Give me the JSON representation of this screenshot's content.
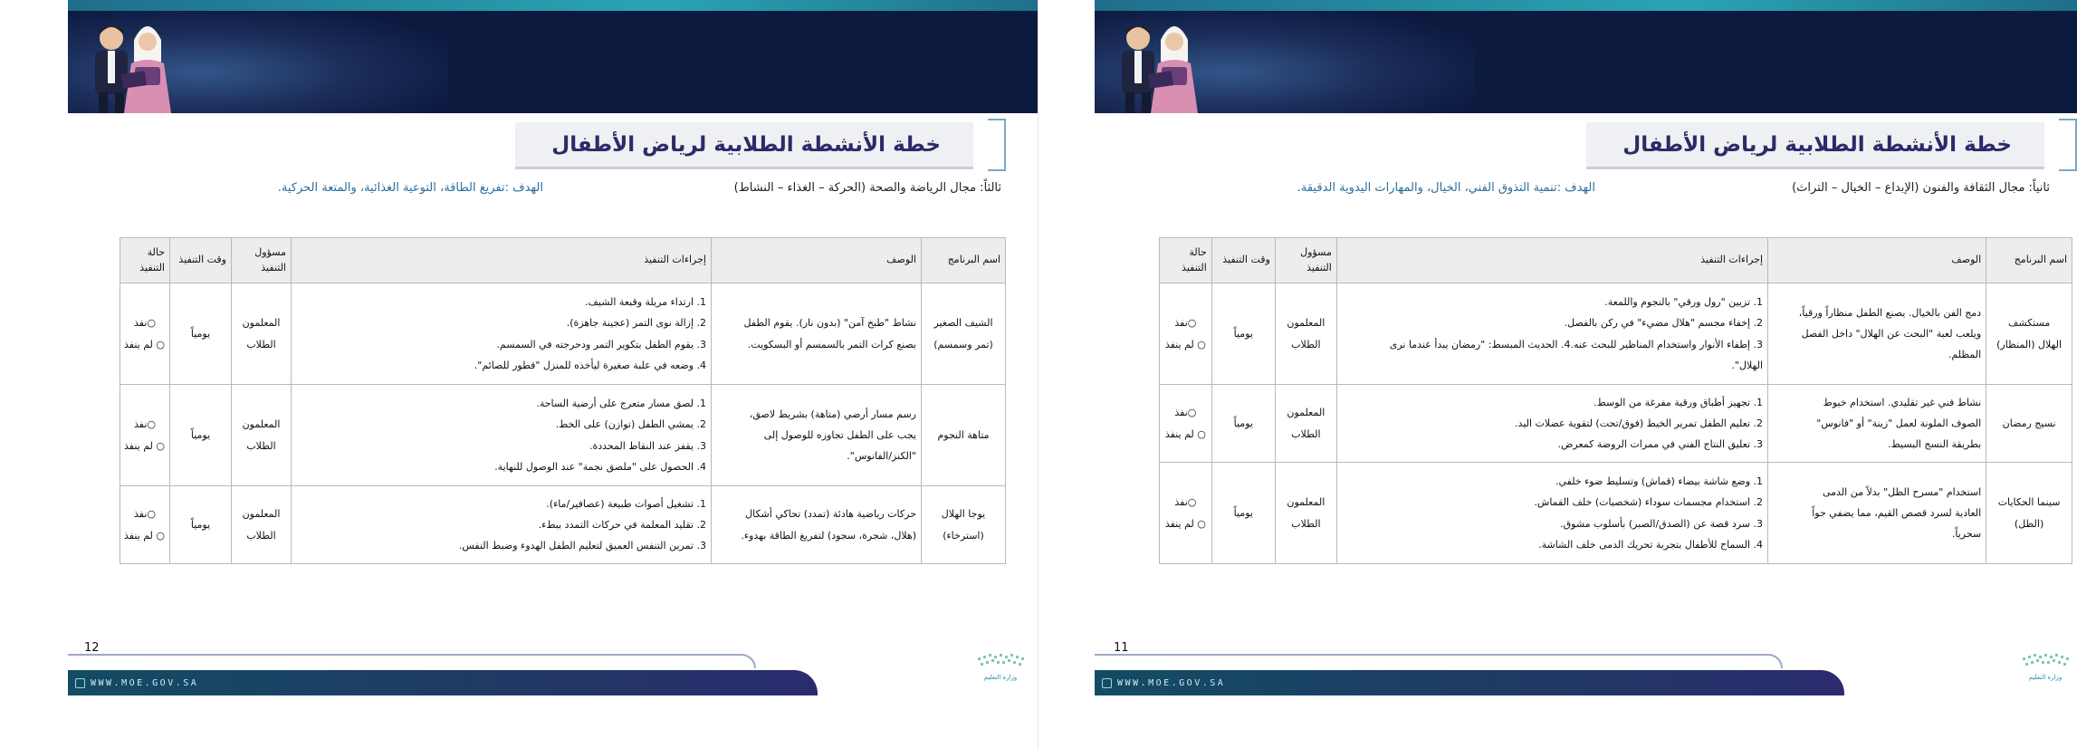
{
  "pages": [
    {
      "page_number": "12",
      "title": "خطة الأنشطة الطلابية لرياض الأطفال",
      "domain": "ثالثاً: مجال الرياضة والصحة (الحركة – الغذاء – النشاط)",
      "goal": "الهدف :تفريغ الطاقة، التوعية الغذائية، والمتعة الحركية.",
      "headers": {
        "name": "اسم البرنامج",
        "desc": "الوصف",
        "steps": "إجراءات التنفيذ",
        "resp_1": "مسؤول",
        "resp_2": "التنفيذ",
        "time": "وقت التنفيذ",
        "status_1": "حالة",
        "status_2": "التنفيذ"
      },
      "rows": [
        {
          "name_1": "الشيف الصغير",
          "name_2": "(تمر وسمسم)",
          "desc_1": "نشاط \"طبخ آمن\" (بدون نار). يقوم الطفل",
          "desc_2": "بصنع كرات التمر بالسمسم أو البسكويت.",
          "desc_3": "",
          "steps": [
            "1. ارتداء مريلة وقبعة الشيف.",
            "2. إزالة نوى التمر (عجينة جاهزة).",
            "3. يقوم الطفل بتكوير التمر ودحرجته في السمسم.",
            "4. وضعه في علبة صغيرة ليأخذه للمنزل \"فطور للصائم\"."
          ],
          "resp_1": "المعلمون",
          "resp_2": "الطلاب",
          "time": "يومياً",
          "status_done": "○نفذ",
          "status_not": "○ لم ينفذ"
        },
        {
          "name_1": "متاهة النجوم",
          "name_2": "",
          "desc_1": "رسم مسار أرضي (متاهة) بشريط لاصق،",
          "desc_2": "يجب على الطفل تجاوزه للوصول إلى",
          "desc_3": "\"الكنز/الفانوس\".",
          "steps": [
            "1. لصق مسار متعرج على أرضية الساحة.",
            "2. يمشي الطفل (توازن) على الخط.",
            "3. يقفز عند النقاط المحددة.",
            "4. الحصول على \"ملصق نجمة\" عند الوصول للنهاية."
          ],
          "resp_1": "المعلمون",
          "resp_2": "الطلاب",
          "time": "يومياً",
          "status_done": "○نفذ",
          "status_not": "○ لم ينفذ"
        },
        {
          "name_1": "يوجا الهلال",
          "name_2": "(استرخاء)",
          "desc_1": "حركات رياضية هادئة (تمدد) تحاكي أشكال",
          "desc_2": "(هلال، شجرة، سجود) لتفريغ الطاقة بهدوء.",
          "desc_3": "",
          "steps": [
            "1. تشغيل أصوات طبيعة (عصافير/ماء).",
            "2. تقليد المعلمة في حركات التمدد ببطء.",
            "3. تمرين التنفس العميق لتعليم الطفل الهدوء وضبط النفس."
          ],
          "resp_1": "المعلمون",
          "resp_2": "الطلاب",
          "time": "يومياً",
          "status_done": "○نفذ",
          "status_not": "○ لم ينفذ"
        }
      ]
    },
    {
      "page_number": "11",
      "title": "خطة الأنشطة الطلابية لرياض الأطفال",
      "domain": "ثانياً: مجال الثقافة والفنون (الإبداع – الخيال – التراث)",
      "goal": "الهدف :تنمية التذوق الفني، الخيال، والمهارات اليدوية الدقيقة.",
      "headers": {
        "name": "اسم البرنامج",
        "desc": "الوصف",
        "steps": "إجراءات التنفيذ",
        "resp_1": "مسؤول",
        "resp_2": "التنفيذ",
        "time": "وقت التنفيذ",
        "status_1": "حالة",
        "status_2": "التنفيذ"
      },
      "rows": [
        {
          "name_1": "مستكشف",
          "name_2": "الهلال (المنظار)",
          "desc_1": "دمج الفن بالخيال. يصنع الطفل منظاراً ورقياً،",
          "desc_2": "ويلعب لعبة \"البحث عن الهلال\" داخل الفصل",
          "desc_3": "المظلم.",
          "steps": [
            "1. تزيين \"رول ورقي\" بالنجوم واللمعة.",
            "2. إخفاء مجسم \"هلال مضيء\" في ركن بالفصل.",
            "3. إطفاء الأنوار واستخدام المناظير للبحث عنه.4. الحديث المبسط: \"رمضان يبدأ عندما نرى",
            "الهلال\"."
          ],
          "resp_1": "المعلمون",
          "resp_2": "الطلاب",
          "time": "يومياً",
          "status_done": "○نفذ",
          "status_not": "○ لم ينفذ"
        },
        {
          "name_1": "نسيج رمضان",
          "name_2": "",
          "desc_1": "نشاط فني غير تقليدي. استخدام خيوط",
          "desc_2": "الصوف الملونة لعمل \"زينة\" أو \"فانوس\"",
          "desc_3": "بطريقة النسج البسيط.",
          "steps": [
            "1. تجهيز أطباق ورقية مفرغة من الوسط.",
            "2. تعليم الطفل تمرير الخيط (فوق/تحت) لتقوية عضلات اليد.",
            "3. تعليق النتاج الفني في ممرات الروضة كمعرض."
          ],
          "resp_1": "المعلمون",
          "resp_2": "الطلاب",
          "time": "يومياً",
          "status_done": "○نفذ",
          "status_not": "○ لم ينفذ"
        },
        {
          "name_1": "سينما الحكايات",
          "name_2": "(الظل)",
          "desc_1": "استخدام \"مسرح الظل\" بدلاً من الدمى",
          "desc_2": "العادية لسرد قصص القيم، مما يضفي جواً",
          "desc_3": "سحرياً.",
          "steps": [
            "1. وضع شاشة بيضاء (قماش) وتسليط ضوء خلفي.",
            "2. استخدام مجسمات سوداء (شخصيات) خلف القماش.",
            "3. سرد قصة عن (الصدق/الصبر) بأسلوب مشوق.",
            "4. السماح للأطفال بتجربة تحريك الدمى خلف الشاشة."
          ],
          "resp_1": "المعلمون",
          "resp_2": "الطلاب",
          "time": "يومياً",
          "status_done": "○نفذ",
          "status_not": "○ لم ينفذ"
        }
      ]
    }
  ],
  "footer": {
    "site": "WWW.MOE.GOV.SA",
    "logo_text": "وزارة التعليم"
  },
  "colors": {
    "title": "#2c2a68",
    "goal": "#2a6f9e",
    "banner": "#0d1a40",
    "footer_bar": "#1f3a63",
    "accent": "#2aa4b4"
  }
}
